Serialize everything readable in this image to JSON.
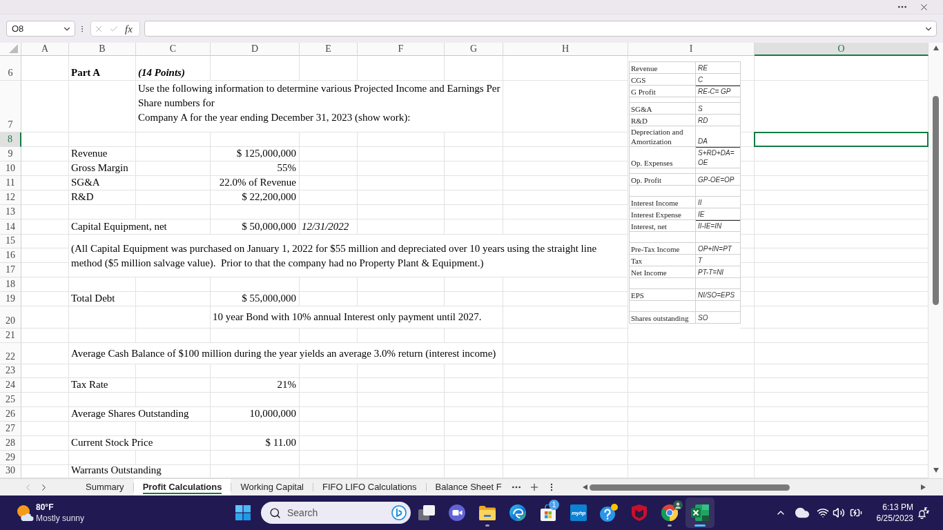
{
  "formula_bar": {
    "name_box": "O8",
    "function_label": "fx"
  },
  "sheet": {
    "columns": [
      {
        "label": "A",
        "selected": false
      },
      {
        "label": "B",
        "selected": false
      },
      {
        "label": "C",
        "selected": false
      },
      {
        "label": "D",
        "selected": false
      },
      {
        "label": "E",
        "selected": false
      },
      {
        "label": "F",
        "selected": false
      },
      {
        "label": "G",
        "selected": false
      },
      {
        "label": "H",
        "selected": false
      },
      {
        "label": "I",
        "selected": false
      },
      {
        "label": "O",
        "selected": true
      }
    ],
    "rows": [
      {
        "number": "6",
        "selected": false,
        "cells": [
          null,
          {
            "kind": "heading",
            "text": "Part A"
          },
          {
            "kind": "points",
            "text": "(14 Points)"
          }
        ]
      },
      {
        "number": "7",
        "selected": false,
        "cells": [
          null,
          null,
          {
            "kind": "intro",
            "text": "Use the following information to determine various Projected Income and Earnings Per\nShare numbers for\nCompany A for the year ending December 31, 2023 (show work):"
          },
          {
            "kind": "merge_left"
          },
          {
            "kind": "merge_left"
          },
          {
            "kind": "merge_left"
          },
          {
            "kind": "merge_left"
          }
        ]
      },
      {
        "number": "8",
        "selected": true
      },
      {
        "number": "9",
        "selected": false,
        "cells": [
          null,
          {
            "kind": "label",
            "text": "Revenue"
          },
          null,
          {
            "kind": "amount",
            "text": "$ 125,000,000"
          }
        ]
      },
      {
        "number": "10",
        "selected": false,
        "cells": [
          null,
          {
            "kind": "label",
            "text": "Gross Margin"
          },
          null,
          {
            "kind": "amount",
            "text": "55%"
          }
        ]
      },
      {
        "number": "11",
        "selected": false,
        "cells": [
          null,
          {
            "kind": "label",
            "text": "SG&A"
          },
          null,
          {
            "kind": "amount",
            "text": "22.0% of Revenue"
          }
        ]
      },
      {
        "number": "12",
        "selected": false,
        "cells": [
          null,
          {
            "kind": "label",
            "text": "R&D"
          },
          null,
          {
            "kind": "amount",
            "text": "$ 22,200,000"
          }
        ]
      },
      {
        "number": "13",
        "selected": false
      },
      {
        "number": "14",
        "selected": false,
        "cells": [
          null,
          {
            "kind": "label",
            "text": "Capital Equipment, net"
          },
          {
            "kind": "merge_left"
          },
          {
            "kind": "amount",
            "text": "$ 50,000,000"
          },
          {
            "kind": "date",
            "text": "12/31/2022"
          }
        ]
      },
      {
        "number": "15",
        "selected": false,
        "cells": [
          null,
          {
            "kind": "note",
            "text": "(All Capital Equipment was purchased on January 1, 2022 for $55 million and depreciated over 10 years using the straight line\nmethod ($5 million salvage value).  Prior to that the company had no Property Plant & Equipment.)"
          },
          {
            "kind": "merge_left"
          },
          {
            "kind": "merge_left"
          },
          {
            "kind": "merge_left"
          },
          {
            "kind": "merge_left"
          },
          {
            "kind": "merge_left"
          },
          {
            "kind": "merge_left"
          }
        ]
      },
      {
        "number": "16",
        "selected": false,
        "cells": [
          null,
          {
            "kind": "merge_up"
          }
        ]
      },
      {
        "number": "17",
        "selected": false,
        "cells": [
          null,
          {
            "kind": "merge_up"
          }
        ]
      },
      {
        "number": "18",
        "selected": false
      },
      {
        "number": "19",
        "selected": false,
        "cells": [
          null,
          {
            "kind": "label",
            "text": "Total Debt"
          },
          null,
          {
            "kind": "amount",
            "text": "$ 55,000,000"
          }
        ]
      },
      {
        "number": "20",
        "selected": false,
        "cells": [
          null,
          null,
          null,
          {
            "kind": "note",
            "text": "10 year Bond with 10% annual Interest only payment until 2027."
          },
          {
            "kind": "merge_left"
          },
          {
            "kind": "merge_left"
          },
          {
            "kind": "merge_left"
          }
        ]
      },
      {
        "number": "21",
        "selected": false
      },
      {
        "number": "22",
        "selected": false,
        "cells": [
          null,
          {
            "kind": "note",
            "text": "Average Cash Balance of $100 million during the year yields an average 3.0% return (interest income)"
          },
          {
            "kind": "merge_left"
          },
          {
            "kind": "merge_left"
          },
          {
            "kind": "merge_left"
          },
          {
            "kind": "merge_left"
          },
          {
            "kind": "merge_left"
          }
        ]
      },
      {
        "number": "23",
        "selected": false
      },
      {
        "number": "24",
        "selected": false,
        "cells": [
          null,
          {
            "kind": "label",
            "text": "Tax Rate"
          },
          null,
          {
            "kind": "amount",
            "text": "21%"
          }
        ]
      },
      {
        "number": "25",
        "selected": false
      },
      {
        "number": "26",
        "selected": false,
        "cells": [
          null,
          {
            "kind": "label",
            "text": "Average Shares Outstanding"
          },
          {
            "kind": "merge_left"
          },
          {
            "kind": "amount",
            "text": "10,000,000"
          }
        ]
      },
      {
        "number": "27",
        "selected": false
      },
      {
        "number": "28",
        "selected": false,
        "cells": [
          null,
          {
            "kind": "label",
            "text": "Current Stock Price"
          },
          {
            "kind": "merge_left"
          },
          {
            "kind": "amount",
            "text": "$ 11.00"
          }
        ]
      },
      {
        "number": "29",
        "selected": false
      },
      {
        "number": "30",
        "selected": false,
        "cells": [
          null,
          {
            "kind": "label",
            "text": "Warrants Outstanding"
          },
          {
            "kind": "merge_left"
          }
        ]
      }
    ]
  },
  "formula_key": {
    "rows": [
      {
        "kind": "line",
        "label": "Revenue",
        "formula": "RE",
        "ruled": false
      },
      {
        "kind": "line",
        "label": "CGS",
        "formula": "C",
        "ruled": false
      },
      {
        "kind": "line",
        "label": "G Profit",
        "formula": "RE-C= GP",
        "ruled": true
      },
      {
        "kind": "spacer"
      },
      {
        "kind": "line",
        "label": "SG&A",
        "formula": "S",
        "ruled": false
      },
      {
        "kind": "line",
        "label": "R&D",
        "formula": "RD",
        "ruled": false
      },
      {
        "kind": "line",
        "label": "Depreciation and Amortization",
        "formula": "DA",
        "ruled": false
      },
      {
        "kind": "line",
        "label": "Op. Expenses",
        "formula": "S+RD+DA= OE",
        "ruled": true
      },
      {
        "kind": "spacer"
      },
      {
        "kind": "line",
        "label": "Op. Profit",
        "formula": "GP-OE=OP",
        "ruled": false
      },
      {
        "kind": "blank"
      },
      {
        "kind": "line",
        "label": "Interest Income",
        "formula": "II",
        "ruled": false
      },
      {
        "kind": "line",
        "label": "Interest Expense",
        "formula": "IE",
        "ruled": false
      },
      {
        "kind": "line",
        "label": "Interest, net",
        "formula": "II-IE=IN",
        "ruled": true
      },
      {
        "kind": "blank"
      },
      {
        "kind": "line",
        "label": "Pre-Tax Income",
        "formula": "OP+IN=PT",
        "ruled": false
      },
      {
        "kind": "line",
        "label": "Tax",
        "formula": "T",
        "ruled": false
      },
      {
        "kind": "line",
        "label": "Net Income",
        "formula": "PT-T=NI",
        "ruled": false
      },
      {
        "kind": "blank"
      },
      {
        "kind": "line",
        "label": "EPS",
        "formula": "NI/SO=EPS",
        "ruled": false
      },
      {
        "kind": "blank"
      },
      {
        "kind": "line",
        "label": "Shares outstanding",
        "formula": "SO",
        "ruled": false
      }
    ]
  },
  "sheet_tabs": {
    "nav": [
      {
        "kind": "previous",
        "disabled": true
      },
      {
        "kind": "next",
        "disabled": false
      }
    ],
    "tabs": [
      {
        "label": "Summary",
        "selected": false
      },
      {
        "label": "Profit Calculations",
        "selected": true
      },
      {
        "label": "Working Capital",
        "selected": false
      },
      {
        "label": "FIFO LIFO Calculations",
        "selected": false
      },
      {
        "label": "Balance Sheet F",
        "selected": false
      }
    ]
  },
  "taskbar": {
    "weather": {
      "temperature": "80°F",
      "condition": "Mostly sunny"
    },
    "search": {
      "placeholder": "Search"
    },
    "apps": [
      {
        "kind": "task-view",
        "running": false,
        "selected": false
      },
      {
        "kind": "meet",
        "running": false,
        "selected": false
      },
      {
        "kind": "file-explorer",
        "running": true,
        "selected": false
      },
      {
        "kind": "edge",
        "running": false,
        "selected": false
      },
      {
        "kind": "store",
        "running": false,
        "selected": false,
        "badge": "1"
      },
      {
        "kind": "myhp",
        "running": false,
        "selected": false,
        "logo_text": "myhp"
      },
      {
        "kind": "help",
        "running": false,
        "selected": false
      },
      {
        "kind": "mcafee",
        "running": false,
        "selected": false
      },
      {
        "kind": "chrome",
        "running": true,
        "selected": false
      },
      {
        "kind": "excel",
        "running": true,
        "selected": true
      }
    ],
    "clock": {
      "time": "6:13 PM",
      "date": "6/25/2023"
    }
  }
}
